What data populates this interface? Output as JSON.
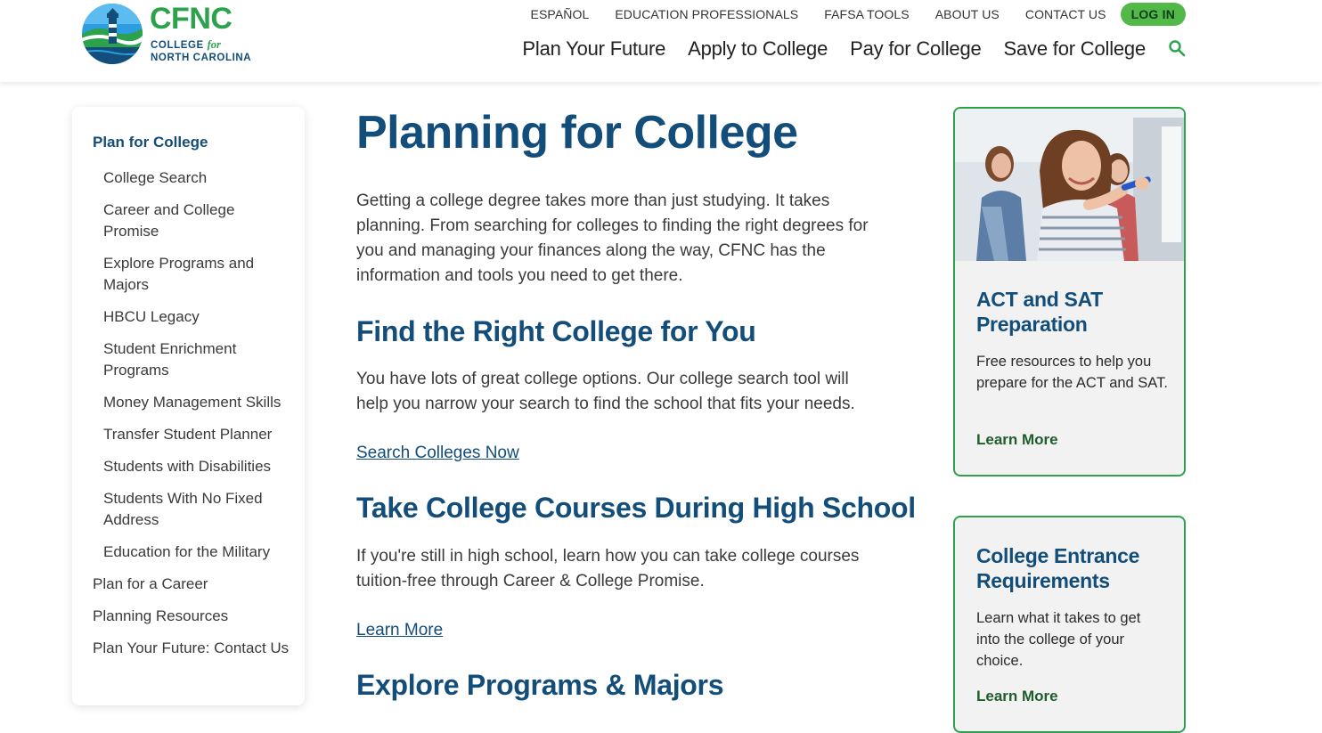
{
  "header": {
    "logo": {
      "word": "CFNC",
      "line1a": "COLLEGE",
      "line1b": "for",
      "line2": "NORTH CAROLINA"
    },
    "utility_nav": [
      "ESPAÑOL",
      "EDUCATION PROFESSIONALS",
      "FAFSA TOOLS",
      "ABOUT US",
      "CONTACT US"
    ],
    "login_label": "LOG IN",
    "main_nav": [
      "Plan Your Future",
      "Apply to College",
      "Pay for College",
      "Save for College"
    ],
    "search_icon": "search-icon"
  },
  "sidebar": {
    "active": "Plan for College",
    "sub_items": [
      "College Search",
      "Career and College Promise",
      "Explore Programs and Majors",
      "HBCU Legacy",
      "Student Enrichment Programs",
      "Money Management Skills",
      "Transfer Student Planner",
      "Students with Disabilities",
      "Students With No Fixed Address",
      "Education for the Military"
    ],
    "items": [
      "Plan for a Career",
      "Planning Resources",
      "Plan Your Future: Contact Us"
    ]
  },
  "main": {
    "title": "Planning for College",
    "intro": "Getting a college degree takes more than just studying. It takes planning. From searching for colleges to finding the right degrees for you and managing your finances along the way, CFNC has the information and tools you need to get there.",
    "sections": [
      {
        "heading": "Find the Right College for You",
        "text": "You have lots of great college options.  Our college search tool will help you narrow your search to find the school that fits your needs.",
        "link": "Search Colleges Now"
      },
      {
        "heading": "Take College Courses During High School",
        "text": "If you're still in high school, learn how you can take college courses tuition-free through Career & College Promise.",
        "link": "Learn More"
      },
      {
        "heading": "Explore Programs & Majors"
      }
    ]
  },
  "cards": [
    {
      "title": "ACT and SAT Preparation",
      "text": "Free resources to help you prepare for the ACT and SAT.",
      "link": "Learn More"
    },
    {
      "title": "College Entrance Requirements",
      "text": "Learn what it takes to get into the college of your choice.",
      "link": "Learn More"
    }
  ],
  "colors": {
    "brand_blue": "#134d7a",
    "brand_green": "#2ca24c",
    "login_green": "#52b848"
  }
}
